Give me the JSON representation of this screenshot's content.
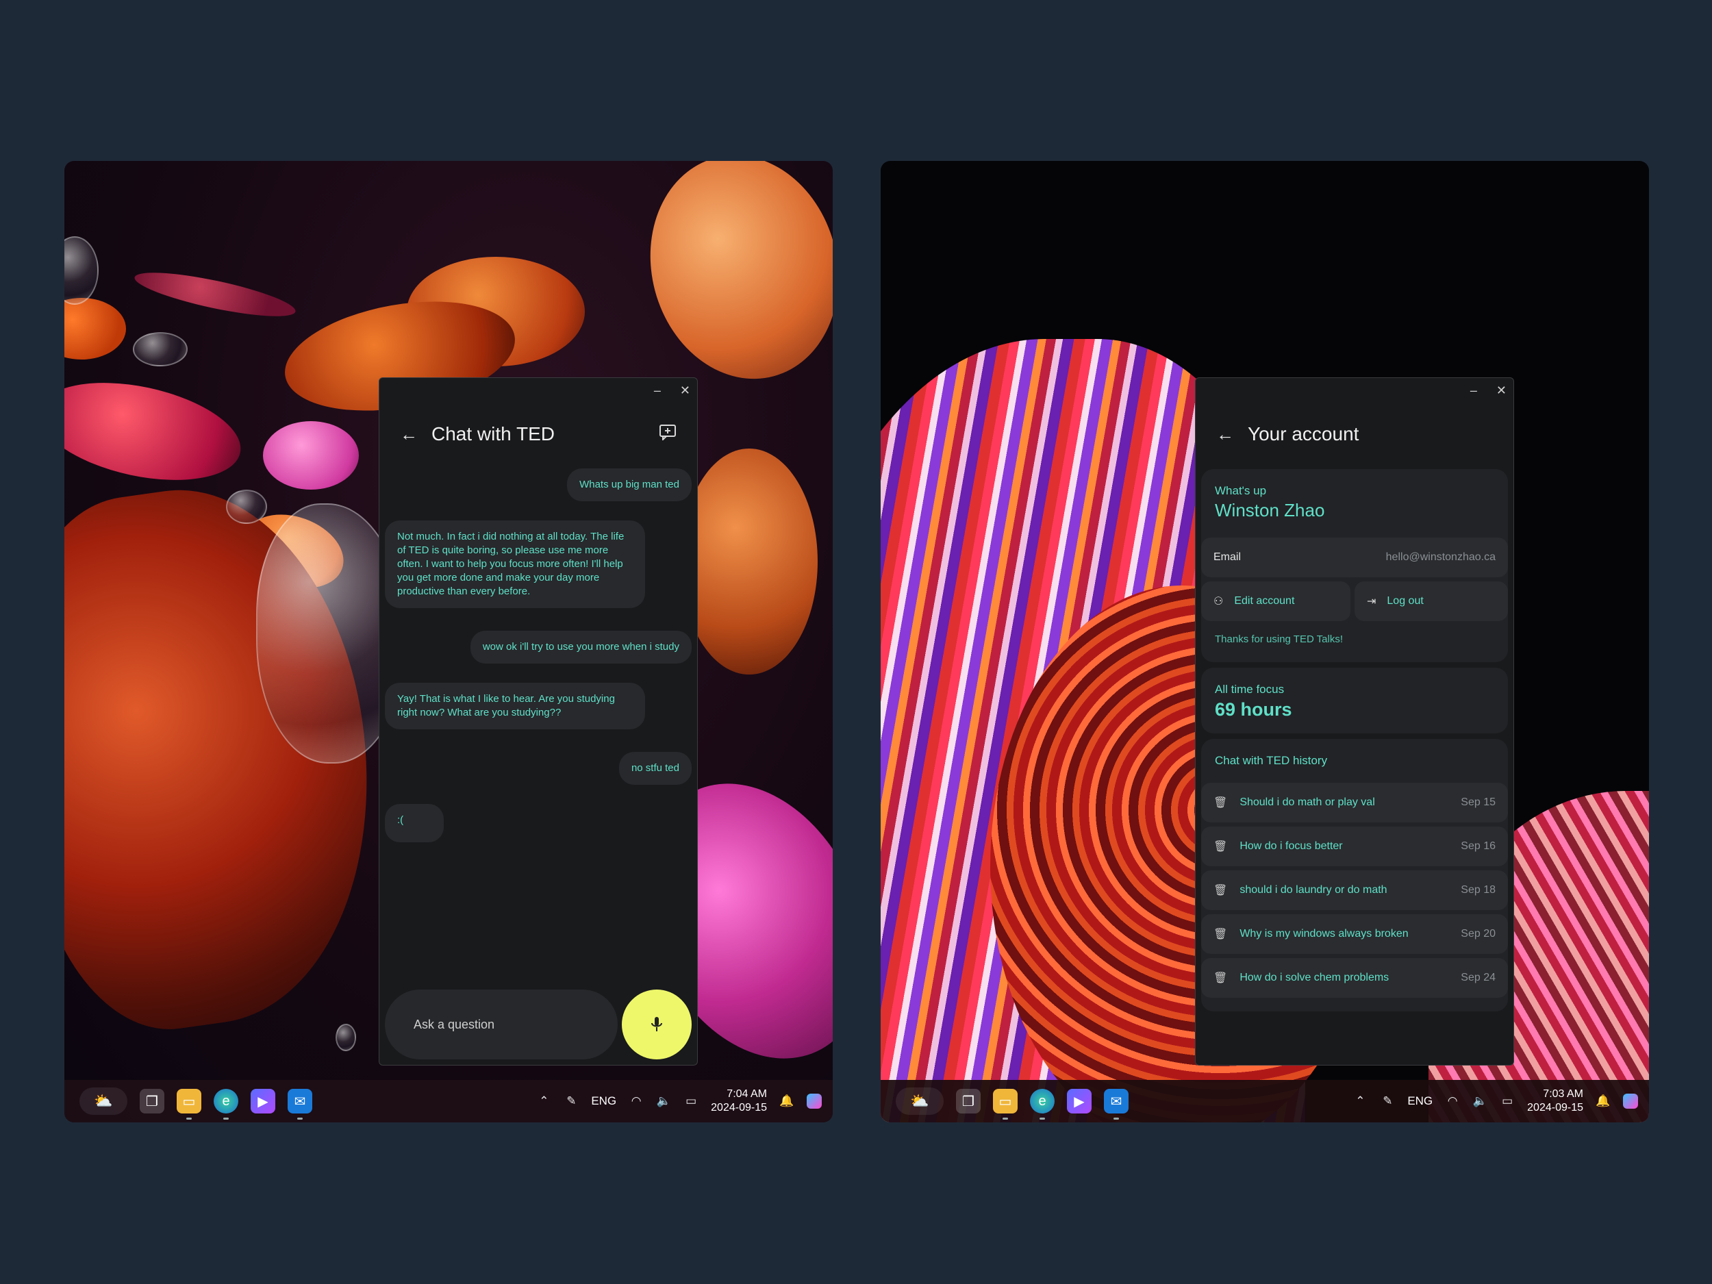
{
  "left_screen": {
    "chat_window": {
      "title": "Chat with TED",
      "minimize": "–",
      "close": "✕",
      "messages": [
        {
          "from": "user",
          "text": "Whats up big man ted"
        },
        {
          "from": "ted",
          "text": "Not much. In fact i did nothing at all today. The life of TED is quite boring, so please use me more often. I want to help you focus more often! I'll help you get more done and make your day more productive than every before."
        },
        {
          "from": "user",
          "text": "wow ok i'll try to use you more when i study"
        },
        {
          "from": "ted",
          "text": "Yay! That is what I like to hear. Are you studying right now? What are you studying??"
        },
        {
          "from": "user",
          "text": "no stfu ted"
        },
        {
          "from": "ted",
          "text": ":("
        }
      ],
      "input_placeholder": "Ask a question"
    },
    "taskbar": {
      "language": "ENG",
      "time": "7:04 AM",
      "date": "2024-09-15"
    }
  },
  "right_screen": {
    "account_window": {
      "title": "Your account",
      "minimize": "–",
      "close": "✕",
      "greeting": "What's up",
      "name": "Winston Zhao",
      "email_label": "Email",
      "email_value": "hello@winstonzhao.ca",
      "edit_label": "Edit account",
      "logout_label": "Log out",
      "thanks": "Thanks for using TED Talks!",
      "focus_label": "All time focus",
      "focus_value": "69 hours",
      "history_title": "Chat with TED history",
      "history": [
        {
          "title": "Should i do math or play val",
          "date": "Sep 15"
        },
        {
          "title": "How do i focus better",
          "date": "Sep 16"
        },
        {
          "title": "should i do laundry or do math",
          "date": "Sep 18"
        },
        {
          "title": "Why is my windows always broken",
          "date": "Sep 20"
        },
        {
          "title": "How do i solve chem problems",
          "date": "Sep 24"
        }
      ]
    },
    "taskbar": {
      "language": "ENG",
      "time": "7:03 AM",
      "date": "2024-09-15"
    }
  }
}
